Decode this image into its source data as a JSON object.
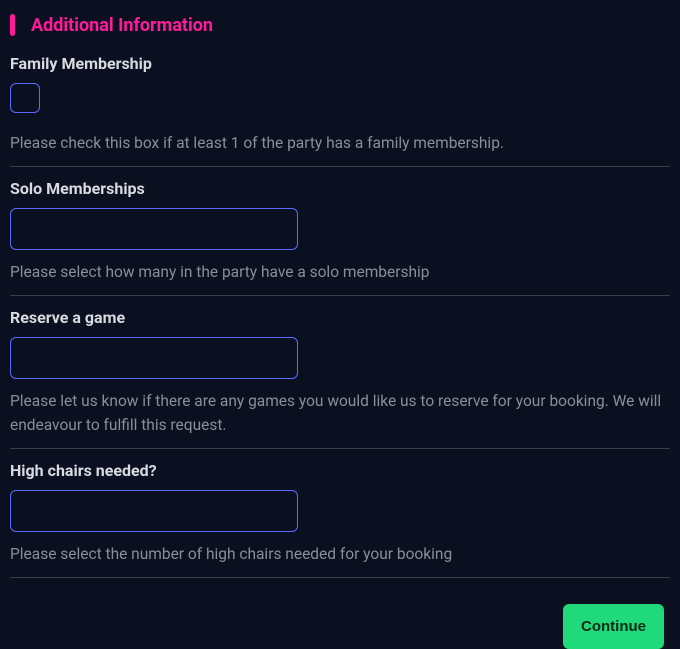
{
  "section": {
    "title": "Additional Information"
  },
  "fields": {
    "family_membership": {
      "label": "Family Membership",
      "helper": "Please check this box if at least 1 of the party has a family membership."
    },
    "solo_memberships": {
      "label": "Solo Memberships",
      "value": "",
      "helper": "Please select how many in the party have a solo membership"
    },
    "reserve_game": {
      "label": "Reserve a game",
      "value": "",
      "helper": "Please let us know if there are any games you would like us to reserve for your booking. We will endeavour to fulfill this request."
    },
    "high_chairs": {
      "label": "High chairs needed?",
      "value": "",
      "helper": "Please select the number of high chairs needed for your booking"
    }
  },
  "actions": {
    "continue_label": "Continue"
  },
  "colors": {
    "accent_pink": "#ff1a9c",
    "accent_green": "#1fd97a",
    "input_border": "#5a6bff",
    "background": "#0b1020",
    "divider": "#3a3f4d",
    "helper_text": "#8a8e99",
    "label_text": "#d9dbe0"
  }
}
